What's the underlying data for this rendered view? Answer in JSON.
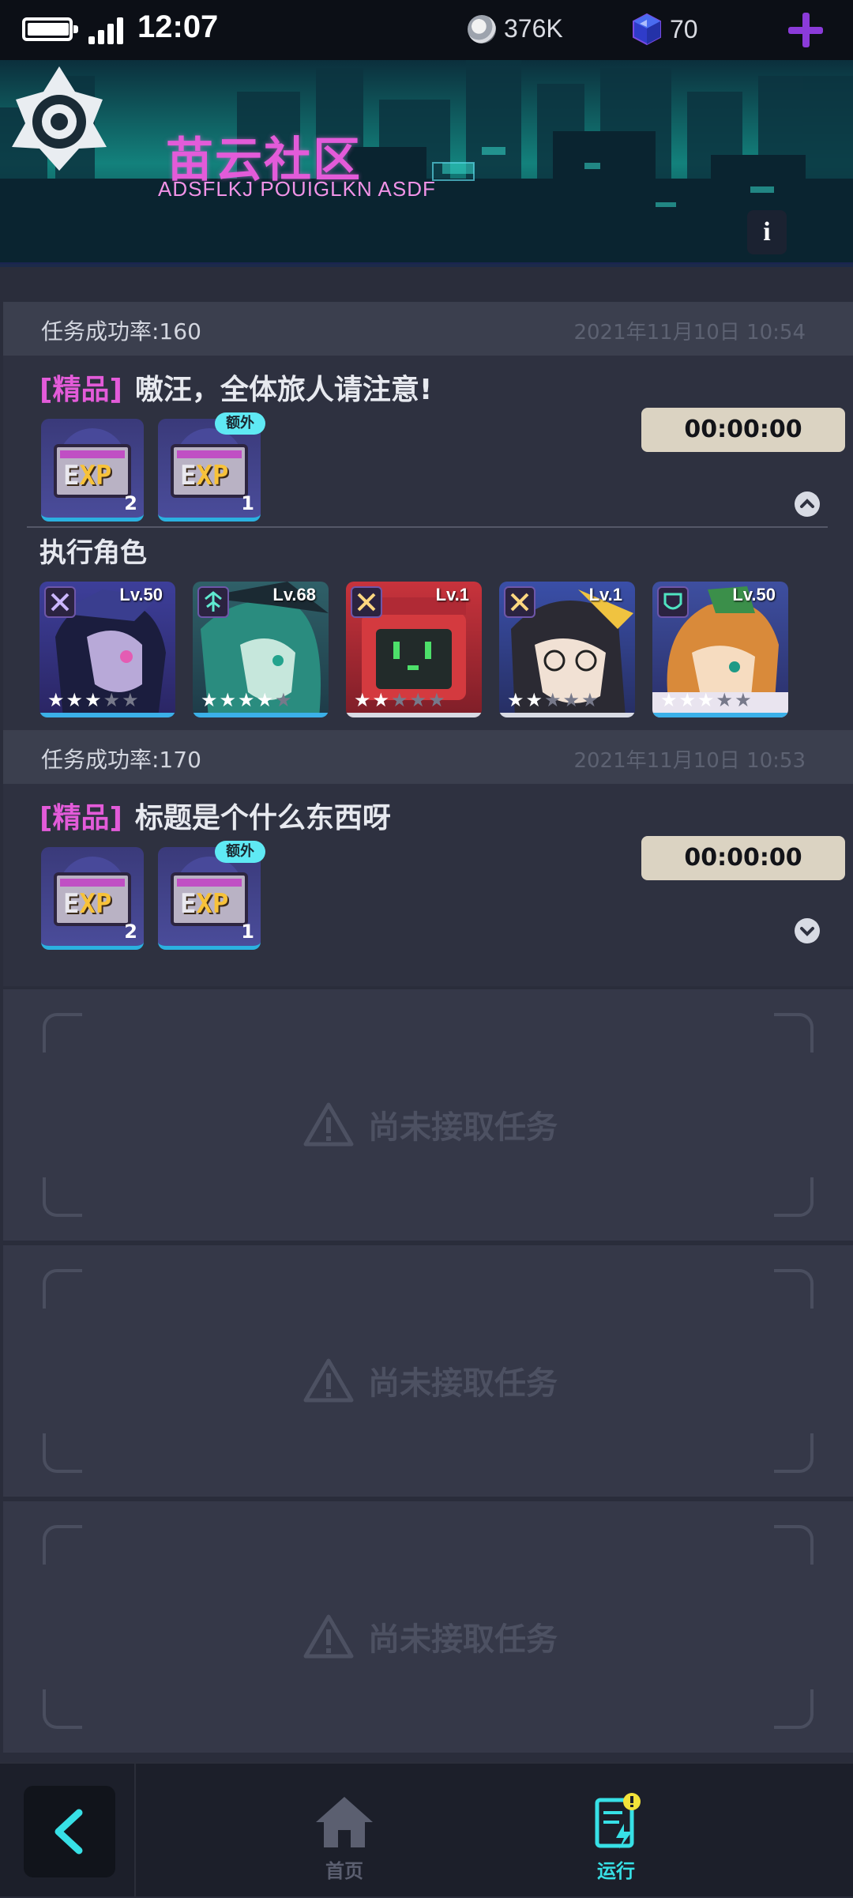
{
  "status_bar": {
    "time": "12:07",
    "battery_level": 0.9,
    "coins": "376K",
    "gems": "70"
  },
  "header": {
    "title": "苗云社区",
    "subtitle": "ADSFLKJ POUIGLKN ASDF",
    "info_label": "i"
  },
  "tasks": [
    {
      "success_rate": "任务成功率:160",
      "time": "2021年11月10日 10:54",
      "tag": "[精品]",
      "title": "嗷汪，全体旅人请注意!",
      "timer": "00:00:00",
      "rewards": [
        {
          "icon": "exp-card-icon",
          "qty": "2"
        },
        {
          "icon": "exp-card-icon",
          "qty": "1",
          "badge": "额外"
        }
      ],
      "expanded": true,
      "roles_title": "执行角色",
      "characters": [
        {
          "level": "Lv.50",
          "role": "swords-icon",
          "stars": 3,
          "max_stars": 5,
          "bar_color": "#3bb0e8"
        },
        {
          "level": "Lv.68",
          "role": "support-icon",
          "stars": 4,
          "max_stars": 5,
          "bar_color": "#3bb0e8"
        },
        {
          "level": "Lv.1",
          "role": "swords-icon",
          "stars": 2,
          "max_stars": 5,
          "bar_color": "#d9dbe4"
        },
        {
          "level": "Lv.1",
          "role": "swords-icon",
          "stars": 2,
          "max_stars": 5,
          "bar_color": "#d9dbe4"
        },
        {
          "level": "Lv.50",
          "role": "shield-icon",
          "stars": 3,
          "max_stars": 5,
          "bar_color": "#3bb0e8"
        }
      ]
    },
    {
      "success_rate": "任务成功率:170",
      "time": "2021年11月10日 10:53",
      "tag": "[精品]",
      "title": "标题是个什么东西呀",
      "timer": "00:00:00",
      "rewards": [
        {
          "icon": "exp-card-icon",
          "qty": "2"
        },
        {
          "icon": "exp-card-icon",
          "qty": "1",
          "badge": "额外"
        }
      ],
      "expanded": false
    }
  ],
  "reward_exp_text": "EXP",
  "empty_slots": [
    {
      "text": "尚未接取任务"
    },
    {
      "text": "尚未接取任务"
    },
    {
      "text": "尚未接取任务"
    }
  ],
  "bottom_nav": {
    "items": [
      {
        "label": "首页",
        "icon": "home-icon",
        "active": false,
        "color": "#5b5f70"
      },
      {
        "label": "运行",
        "icon": "task-run-icon",
        "active": true,
        "color": "#37e0e6"
      }
    ]
  },
  "colors": {
    "accent_pink": "#e35bd9",
    "accent_cyan": "#37e0e6",
    "badge": "#5fe9f4",
    "timer_bg": "#dbd3c2"
  }
}
